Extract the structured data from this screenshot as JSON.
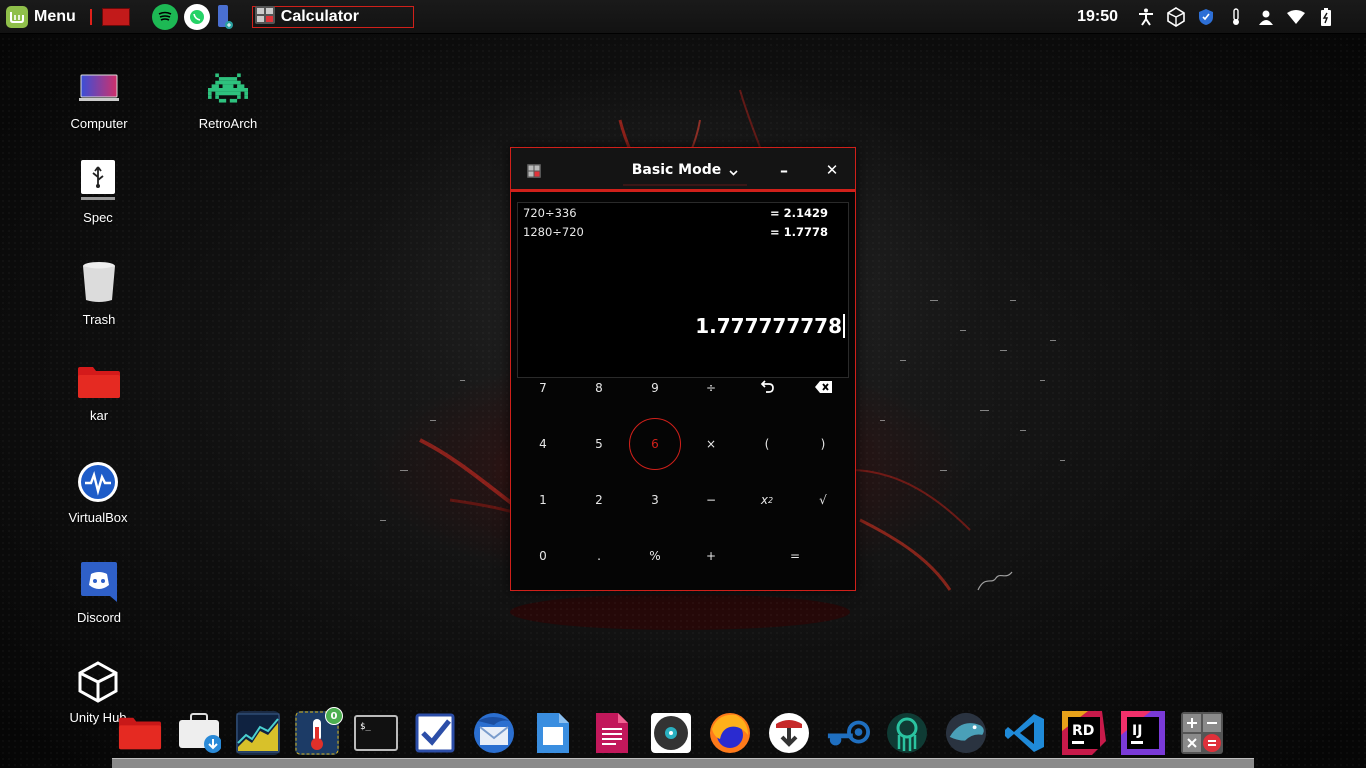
{
  "panel": {
    "menu_label": "Menu",
    "window_title": "Calculator",
    "clock": "19:50",
    "launchers": [
      "spotify-icon",
      "whatsapp-icon",
      "usb-device-icon"
    ],
    "tray_icons": [
      "accessibility-icon",
      "unity-icon",
      "shield-icon",
      "temperature-icon",
      "user-icon",
      "wifi-icon",
      "battery-icon"
    ]
  },
  "desktop": {
    "icons": [
      {
        "label": "Computer",
        "icon": "computer-icon"
      },
      {
        "label": "RetroArch",
        "icon": "retroarch-icon"
      },
      {
        "label": "Spec",
        "icon": "usb-drive-icon"
      },
      {
        "label": "Trash",
        "icon": "trash-icon"
      },
      {
        "label": "kar",
        "icon": "folder-icon"
      },
      {
        "label": "VirtualBox",
        "icon": "virtualbox-icon"
      },
      {
        "label": "Discord",
        "icon": "discord-icon"
      },
      {
        "label": "Unity Hub",
        "icon": "unity-hub-icon"
      }
    ]
  },
  "calculator": {
    "mode_label": "Basic Mode",
    "minimize_glyph": "–",
    "close_glyph": "✕",
    "history": [
      {
        "expr": "720÷336",
        "result": "= 2.1429"
      },
      {
        "expr": "1280÷720",
        "result": "= 1.7778"
      }
    ],
    "display": "1.777777778",
    "keys": {
      "k7": "7",
      "k8": "8",
      "k9": "9",
      "div": "÷",
      "k4": "4",
      "k5": "5",
      "k6": "6",
      "mul": "×",
      "lparen": "(",
      "rparen": ")",
      "k1": "1",
      "k2": "2",
      "k3": "3",
      "minus": "−",
      "sq_base": "x",
      "sq_exp": "2",
      "sqrt": "√",
      "k0": "0",
      "dot": ".",
      "pct": "%",
      "plus": "+",
      "eq": "="
    },
    "active_key": "6",
    "accent_color": "#d0201a"
  },
  "dock": {
    "items": [
      "files-folder-icon",
      "software-store-icon",
      "system-monitor-icon",
      "temperature-app-icon",
      "terminal-icon",
      "tasks-icon",
      "thunderbird-icon",
      "document-viewer-icon",
      "text-editor-icon",
      "rhythmbox-icon",
      "firefox-icon",
      "torrent-icon",
      "steam-icon",
      "gitkraken-icon",
      "mysql-workbench-icon",
      "vscode-icon",
      "rider-icon",
      "intellij-icon",
      "calculator-icon"
    ],
    "badge_count": "0"
  },
  "colors": {
    "accent": "#d0201a",
    "panel_bg": "#141414"
  }
}
